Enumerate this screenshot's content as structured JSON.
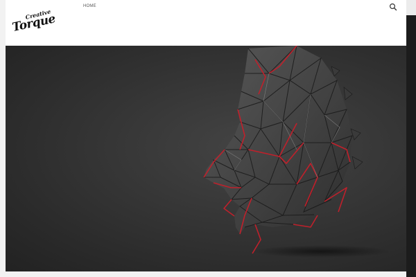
{
  "nav": {
    "home_label": "HOME"
  },
  "logo": {
    "line1": "Creative",
    "line2": "Torque"
  },
  "icons": {
    "search": "search-icon"
  },
  "colors": {
    "hero_background": "#333333",
    "accent_red": "#c0202b",
    "page_background": "#ffffff"
  }
}
